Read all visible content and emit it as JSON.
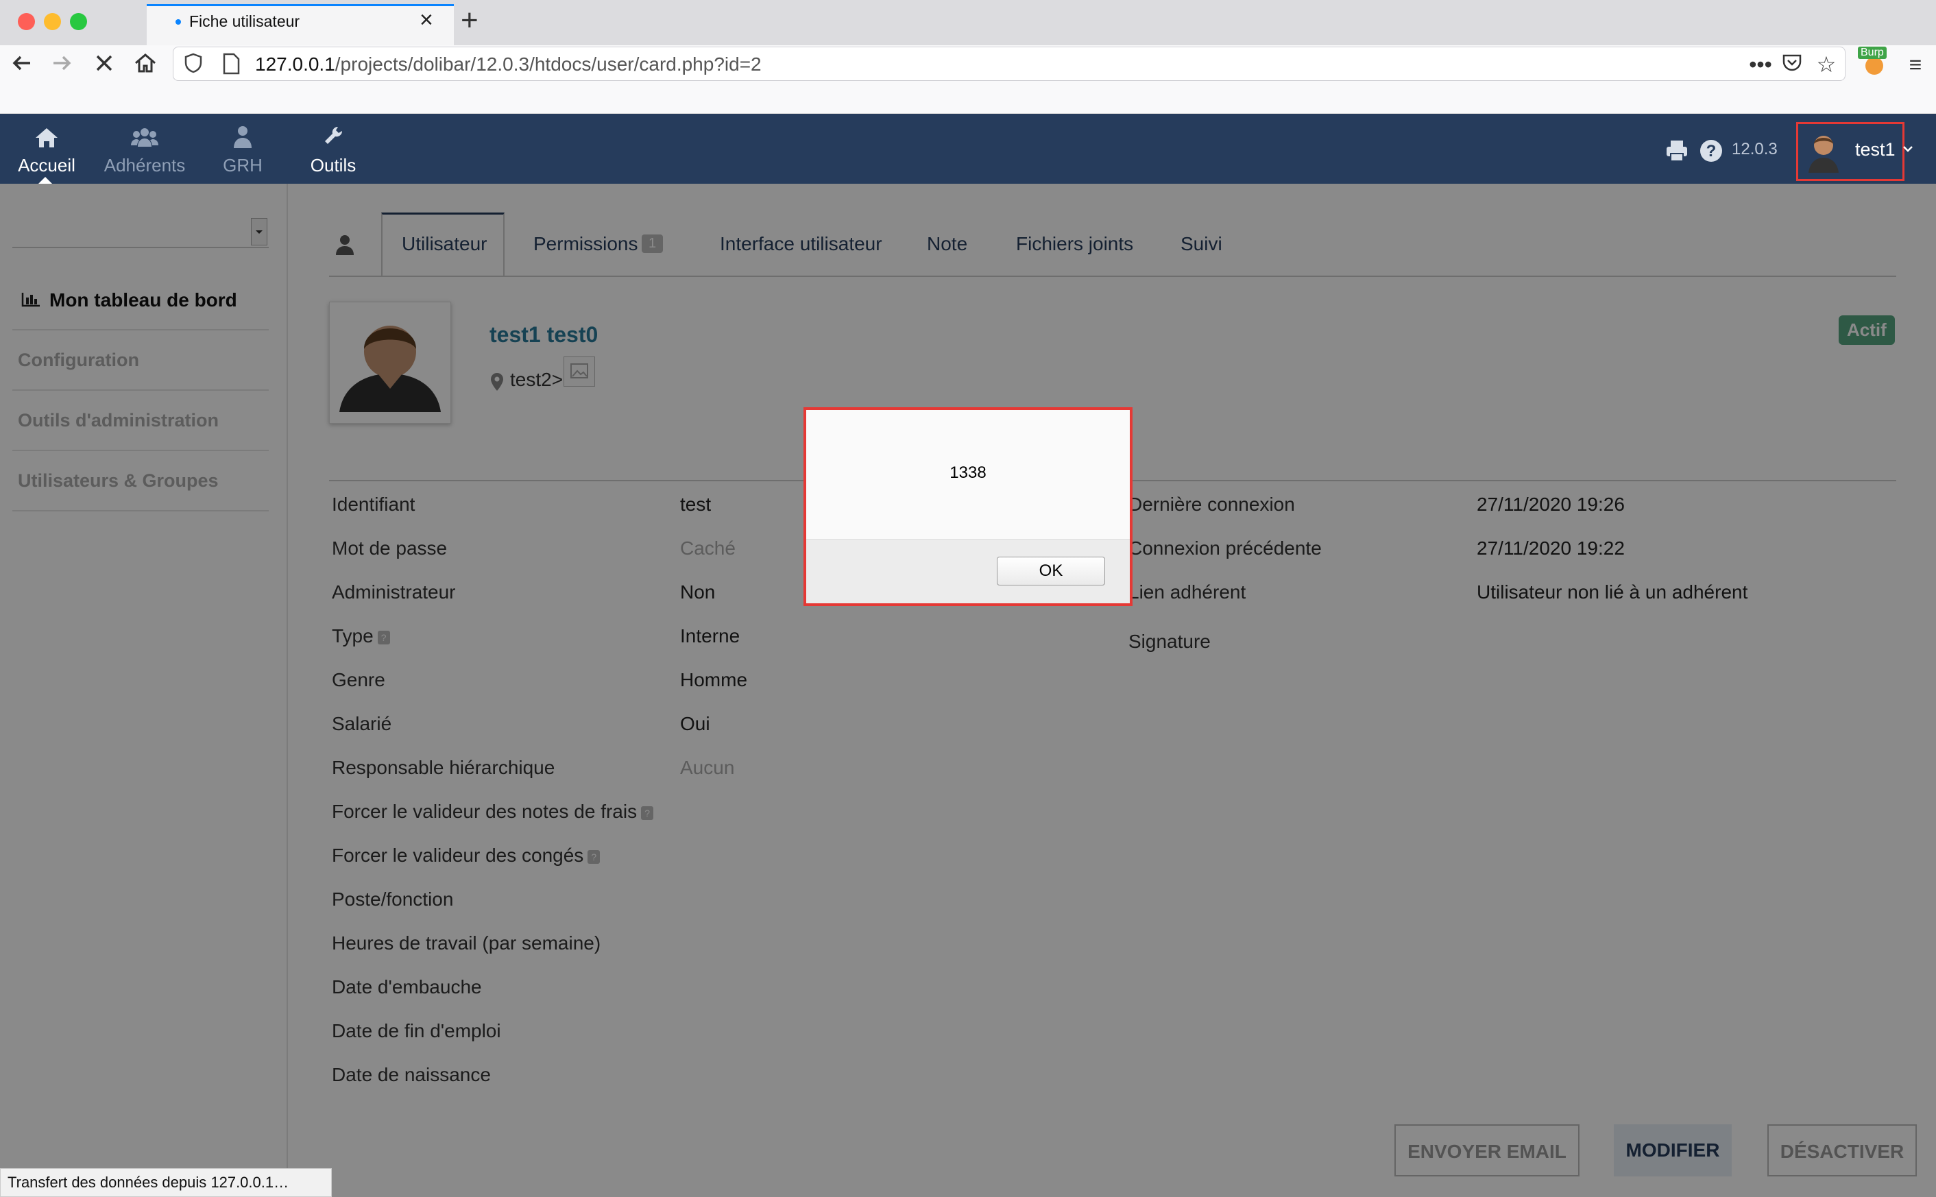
{
  "browser": {
    "tab_title": "Fiche utilisateur",
    "url_host": "127.0.0.1",
    "url_path": "/projects/dolibar/12.0.3/htdocs/user/card.php?id=2",
    "burp_label": "Burp"
  },
  "topmenu": {
    "items": [
      {
        "label": "Accueil",
        "icon": "home-icon",
        "active": true
      },
      {
        "label": "Adhérents",
        "icon": "users-icon"
      },
      {
        "label": "GRH",
        "icon": "person-icon"
      },
      {
        "label": "Outils",
        "icon": "wrench-icon"
      }
    ],
    "version": "12.0.3",
    "user": "test1"
  },
  "sidebar": {
    "dashboard": "Mon tableau de bord",
    "items": [
      "Configuration",
      "Outils d'administration",
      "Utilisateurs & Groupes"
    ]
  },
  "tabs": {
    "items": [
      "Utilisateur",
      "Permissions",
      "Interface utilisateur",
      "Note",
      "Fichiers joints",
      "Suivi"
    ],
    "active": "Utilisateur",
    "permissions_badge": "1"
  },
  "user": {
    "full_name": "test1 test0",
    "location": "test2>",
    "status": "Actif"
  },
  "fields_left": [
    {
      "label": "Identifiant",
      "value": "test"
    },
    {
      "label": "Mot de passe",
      "value": "Caché",
      "muted": true
    },
    {
      "label": "Administrateur",
      "value": "Non"
    },
    {
      "label": "Type",
      "value": "Interne",
      "help": true
    },
    {
      "label": "Genre",
      "value": "Homme"
    },
    {
      "label": "Salarié",
      "value": "Oui"
    },
    {
      "label": "Responsable hiérarchique",
      "value": "Aucun",
      "muted": true
    },
    {
      "label": "Forcer le valideur des notes de frais",
      "value": "",
      "help": true
    },
    {
      "label": "Forcer le valideur des congés",
      "value": "",
      "help": true
    },
    {
      "label": "Poste/fonction",
      "value": ""
    },
    {
      "label": "Heures de travail (par semaine)",
      "value": ""
    },
    {
      "label": "Date d'embauche",
      "value": ""
    },
    {
      "label": "Date de fin d'emploi",
      "value": ""
    },
    {
      "label": "Date de naissance",
      "value": ""
    }
  ],
  "fields_right": [
    {
      "label": "Dernière connexion",
      "value": "27/11/2020 19:26"
    },
    {
      "label": "Connexion précédente",
      "value": "27/11/2020 19:22"
    },
    {
      "label": "Lien adhérent",
      "value": "Utilisateur non lié à un adhérent"
    },
    {
      "label": "Signature",
      "value": ""
    }
  ],
  "actions": {
    "send_email": "ENVOYER EMAIL",
    "modify": "MODIFIER",
    "deactivate": "DÉSACTIVER"
  },
  "status_bar": "Transfert des données depuis 127.0.0.1…",
  "dialog": {
    "message": "1338",
    "ok": "OK"
  },
  "colors": {
    "header_bg": "#263c5c",
    "badge_actif": "#55a580",
    "highlight_red": "#e53935"
  }
}
